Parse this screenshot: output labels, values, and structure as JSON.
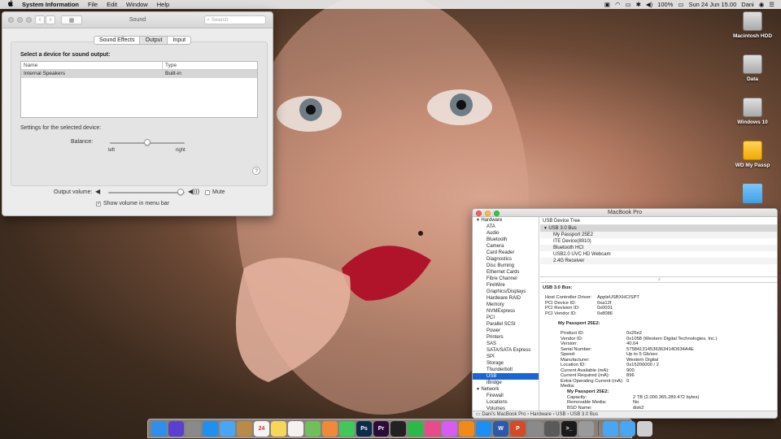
{
  "menubar": {
    "apple": "",
    "items": [
      "System Information",
      "File",
      "Edit",
      "Window",
      "Help"
    ],
    "battery": "100%",
    "clock": "Sun 24 Jun  15.00",
    "user": "Dani"
  },
  "desktop_icons": [
    "Macintosh HDD",
    "Data",
    "Windows 10",
    "WD My Passp"
  ],
  "sound": {
    "title": "Sound",
    "search_placeholder": "Search",
    "tabs": [
      "Sound Effects",
      "Output",
      "Input"
    ],
    "select_label": "Select a device for sound output:",
    "col_name": "Name",
    "col_type": "Type",
    "device_name": "Internal Speakers",
    "device_type": "Built-in",
    "settings_label": "Settings for the selected device:",
    "balance_label": "Balance:",
    "balance_left": "left",
    "balance_right": "right",
    "balance_value": 0.5,
    "help": "?",
    "output_volume_label": "Output volume:",
    "output_volume_value": 0.95,
    "mute_label": "Mute",
    "show_volume_label": "Show volume in menu bar"
  },
  "mbp": {
    "title": "MacBook Pro",
    "sidebar": [
      {
        "label": "Hardware",
        "cat": true
      },
      {
        "label": "ATA"
      },
      {
        "label": "Audio"
      },
      {
        "label": "Bluetooth"
      },
      {
        "label": "Camera"
      },
      {
        "label": "Card Reader"
      },
      {
        "label": "Diagnostics"
      },
      {
        "label": "Disc Burning"
      },
      {
        "label": "Ethernet Cards"
      },
      {
        "label": "Fibre Channel"
      },
      {
        "label": "FireWire"
      },
      {
        "label": "Graphics/Displays"
      },
      {
        "label": "Hardware RAID"
      },
      {
        "label": "Memory"
      },
      {
        "label": "NVMExpress"
      },
      {
        "label": "PCI"
      },
      {
        "label": "Parallel SCSI"
      },
      {
        "label": "Power"
      },
      {
        "label": "Printers"
      },
      {
        "label": "SAS"
      },
      {
        "label": "SATA/SATA Express"
      },
      {
        "label": "SPI"
      },
      {
        "label": "Storage"
      },
      {
        "label": "Thunderbolt"
      },
      {
        "label": "USB",
        "sel": true
      },
      {
        "label": "iBridge"
      },
      {
        "label": "Network",
        "cat": true
      },
      {
        "label": "Firewall"
      },
      {
        "label": "Locations"
      },
      {
        "label": "Volumes"
      }
    ],
    "tree_header": "USB Device Tree",
    "tree": [
      {
        "label": "USB 3.0 Bus",
        "indent": 4,
        "arrow": "▼",
        "sel": true
      },
      {
        "label": "My Passport 25E2",
        "indent": 16
      },
      {
        "label": "ITE Device(8910)",
        "indent": 16
      },
      {
        "label": "Bluetooth HCI",
        "indent": 16
      },
      {
        "label": "USB2.0 UVC HD Webcam",
        "indent": 16
      },
      {
        "label": "2.4G Receiver",
        "indent": 16
      }
    ],
    "detail_title": "USB 3.0 Bus:",
    "bus_props": [
      [
        "Host Controller Driver:",
        "AppleUSBXHCISPT"
      ],
      [
        "PCI Device ID:",
        "0xa12f"
      ],
      [
        "PCI Revision ID:",
        "0x0031"
      ],
      [
        "PCI Vendor ID:",
        "0x8086"
      ]
    ],
    "device_title": "My Passport 25E2:",
    "device_props": [
      [
        "Product ID:",
        "0x25e2"
      ],
      [
        "Vendor ID:",
        "0x1058  (Western Digital Technologies, Inc.)"
      ],
      [
        "Version:",
        "40.04"
      ],
      [
        "Serial Number:",
        "575841314536363414D634A4E"
      ],
      [
        "Speed:",
        "Up to 5 Gb/sec"
      ],
      [
        "Manufacturer:",
        "Western Digital"
      ],
      [
        "Location ID:",
        "0x15200000 / 2"
      ],
      [
        "Current Available (mA):",
        "900"
      ],
      [
        "Current Required (mA):",
        "896"
      ],
      [
        "Extra Operating Current (mA):",
        "0"
      ]
    ],
    "media_label": "Media:",
    "media_title": "My Passport 25E2:",
    "media_props": [
      [
        "Capacity:",
        "2 TB (2.000.365.289.472 bytes)"
      ],
      [
        "Removable Media:",
        "No"
      ],
      [
        "BSD Name:",
        "disk2"
      ]
    ],
    "breadcrumb": "Dani's MacBook Pro  ›  Hardware  ›  USB  ›  USB 3.0 Bus"
  },
  "dock": {
    "apps": [
      {
        "name": "finder-icon",
        "color": "#2f8fea",
        "glyph": ""
      },
      {
        "name": "siri-icon",
        "color": "#5a3fd1",
        "glyph": ""
      },
      {
        "name": "launchpad-icon",
        "color": "#8a8a8a",
        "glyph": ""
      },
      {
        "name": "safari-icon",
        "color": "#1f8ff0",
        "glyph": ""
      },
      {
        "name": "mail-icon",
        "color": "#4aa6f5",
        "glyph": ""
      },
      {
        "name": "contacts-icon",
        "color": "#b88b4a",
        "glyph": ""
      },
      {
        "name": "calendar-icon",
        "color": "#f5f5f5",
        "glyph": "24"
      },
      {
        "name": "notes-icon",
        "color": "#f7d75a",
        "glyph": ""
      },
      {
        "name": "reminders-icon",
        "color": "#f2f2f2",
        "glyph": ""
      },
      {
        "name": "maps-icon",
        "color": "#6fbf5a",
        "glyph": ""
      },
      {
        "name": "photos-icon",
        "color": "#f08a3a",
        "glyph": ""
      },
      {
        "name": "messages-icon",
        "color": "#41c85a",
        "glyph": ""
      },
      {
        "name": "photoshop-icon",
        "color": "#0c2a4a",
        "glyph": "Ps"
      },
      {
        "name": "premiere-icon",
        "color": "#2a0b3a",
        "glyph": "Pr"
      },
      {
        "name": "finalcut-icon",
        "color": "#222222",
        "glyph": ""
      },
      {
        "name": "facetime-icon",
        "color": "#2db84a",
        "glyph": ""
      },
      {
        "name": "itunes-icon",
        "color": "#e94a8a",
        "glyph": ""
      },
      {
        "name": "itunes-store-icon",
        "color": "#d95cf0",
        "glyph": ""
      },
      {
        "name": "ibooks-icon",
        "color": "#f28a1a",
        "glyph": ""
      },
      {
        "name": "appstore-icon",
        "color": "#1d8ff2",
        "glyph": ""
      },
      {
        "name": "word-icon",
        "color": "#2a5aa8",
        "glyph": "W"
      },
      {
        "name": "powerpoint-icon",
        "color": "#d24a26",
        "glyph": "P"
      },
      {
        "name": "system-prefs-icon",
        "color": "#8a8a8a",
        "glyph": ""
      },
      {
        "name": "system-info-icon",
        "color": "#5a5a5a",
        "glyph": ""
      },
      {
        "name": "terminal-icon",
        "color": "#1a1a1a",
        "glyph": ">_"
      },
      {
        "name": "automator-icon",
        "color": "#9a9a9a",
        "glyph": ""
      }
    ],
    "trailing": [
      {
        "name": "downloads-folder-icon",
        "color": "#4aa6f0"
      },
      {
        "name": "documents-folder-icon",
        "color": "#4aa6f0"
      },
      {
        "name": "trash-icon",
        "color": "#cfcfcf"
      }
    ]
  }
}
